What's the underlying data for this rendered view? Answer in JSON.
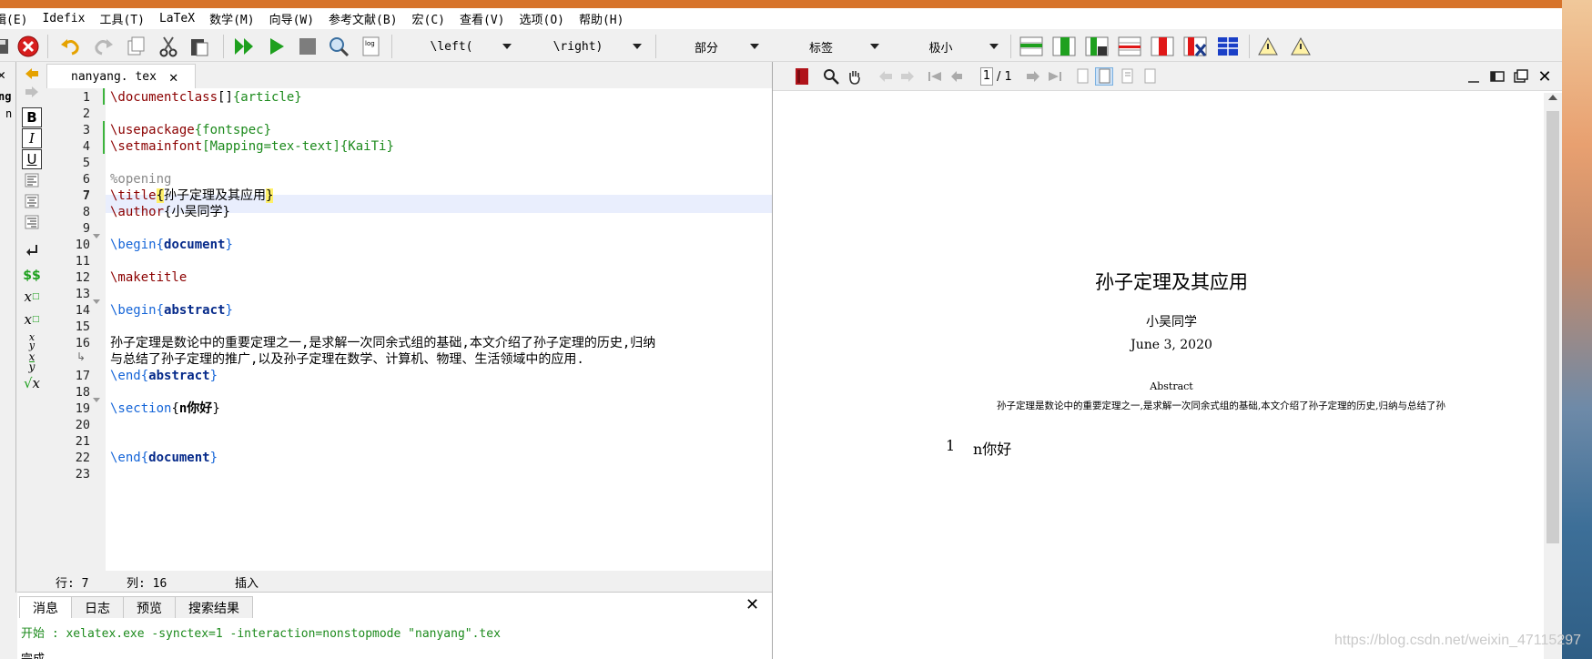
{
  "menu": [
    "辑(E)",
    "Idefix",
    "工具(T)",
    "LaTeX",
    "数学(M)",
    "向导(W)",
    "参考文献(B)",
    "宏(C)",
    "查看(V)",
    "选项(O)",
    "帮助(H)"
  ],
  "toolbar": {
    "left_delim": "\\left(",
    "right_delim": "\\right)",
    "section_combo": "部分",
    "label_combo": "标签",
    "size_combo": "极小"
  },
  "left_strip": {
    "line1": "ng",
    "line2": "n"
  },
  "tab": {
    "filename": "nanyang. tex"
  },
  "editor": {
    "line_numbers": [
      "1",
      "2",
      "3",
      "4",
      "5",
      "6",
      "7",
      "8",
      "9",
      "10",
      "11",
      "12",
      "13",
      "14",
      "15",
      "16",
      "",
      "17",
      "18",
      "19",
      "20",
      "21",
      "22",
      "23"
    ],
    "lines": {
      "l1": {
        "cmd": "\\documentclass",
        "opt": "[]",
        "arg": "{article}"
      },
      "l3": {
        "cmd": "\\usepackage",
        "arg": "{fontspec}"
      },
      "l4": {
        "cmd": "\\setmainfont",
        "opt": "[Mapping=tex-text]",
        "arg": "{KaiTi}"
      },
      "l6": {
        "comment": "%opening"
      },
      "l7": {
        "cmd": "\\title",
        "ob": "{",
        "text": "孙子定理及其应用",
        "cb": "}"
      },
      "l8": {
        "cmd": "\\author",
        "arg": "{小吴同学}"
      },
      "l10": {
        "cmd": "\\begin",
        "ob": "{",
        "env": "document",
        "cb": "}"
      },
      "l12": {
        "cmd": "\\maketitle"
      },
      "l14": {
        "cmd": "\\begin",
        "ob": "{",
        "env": "abstract",
        "cb": "}"
      },
      "l16a": "孙子定理是数论中的重要定理之一,是求解一次同余式组的基础,本文介绍了孙子定理的历史,归纳",
      "l16b": "与总结了孙子定理的推广,以及孙子定理在数学、计算机、物理、生活领域中的应用.",
      "l17": {
        "cmd": "\\end",
        "ob": "{",
        "env": "abstract",
        "cb": "}"
      },
      "l19": {
        "cmd": "\\section",
        "ob": "{",
        "text": "n你好",
        "cb": "}"
      },
      "l22": {
        "cmd": "\\end",
        "ob": "{",
        "env": "document",
        "cb": "}"
      }
    }
  },
  "status": {
    "row": "行: 7",
    "col": "列: 16",
    "mode": "插入"
  },
  "messages": {
    "tabs": [
      "消息",
      "日志",
      "预览",
      "搜索结果"
    ],
    "start_label": "开始 :",
    "command": "xelatex.exe -synctex=1 -interaction=nonstopmode \"nanyang\".tex",
    "done": "完成"
  },
  "pdf": {
    "page_input": "1",
    "page_total": "/ 1",
    "title": "孙子定理及其应用",
    "author": "小吴同学",
    "date": "June 3, 2020",
    "abstract_heading": "Abstract",
    "abstract_text": "孙子定理是数论中的重要定理之一,是求解一次同余式组的基础,本文介绍了孙子定理的历史,归纳与总结了孙",
    "section_number": "1",
    "section_title": "n你好"
  },
  "watermark": "https://blog.csdn.net/weixin_47115297",
  "colors": {
    "titlebar": "#d7742b",
    "keyword": "#8b0000",
    "argument": "#1c8a1c",
    "environment": "#1565d8",
    "current_line": "#e9eefd"
  }
}
